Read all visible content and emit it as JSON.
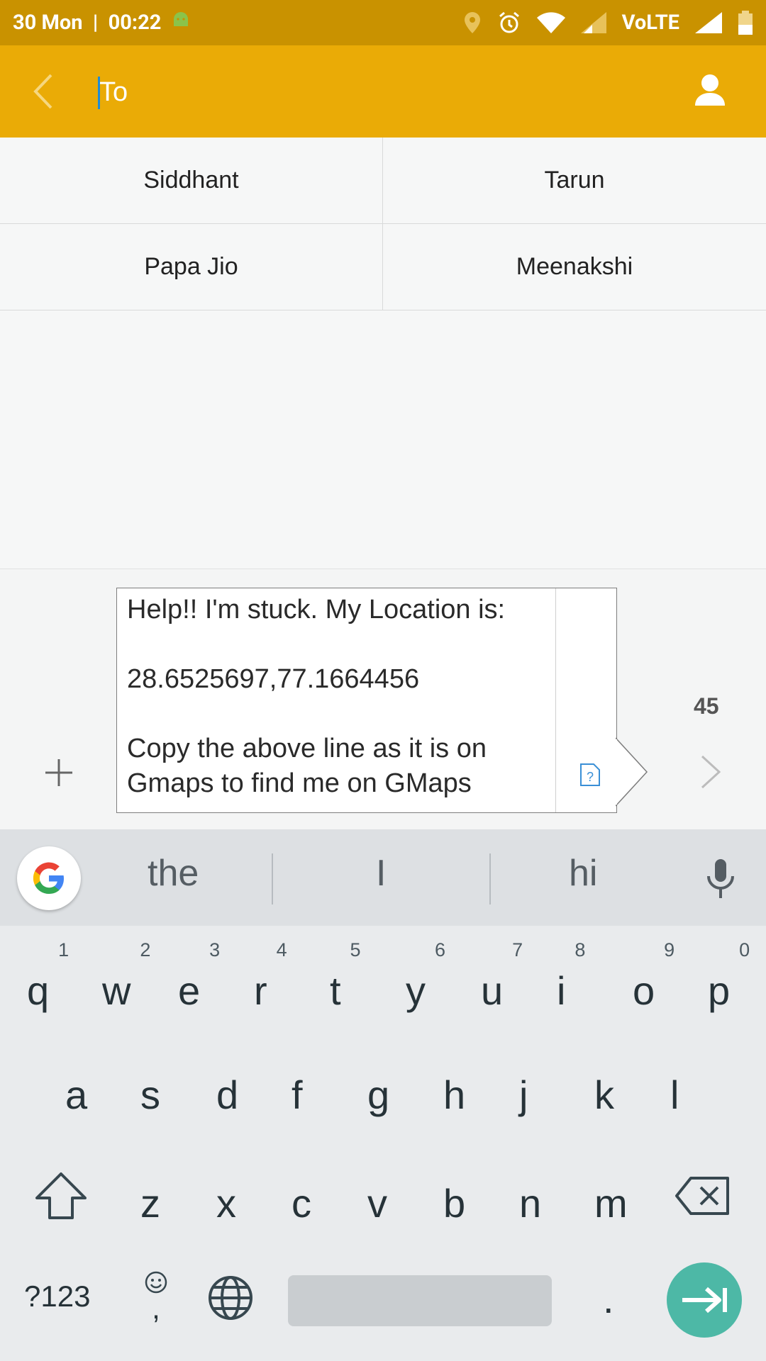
{
  "status_bar": {
    "date_time": "30 Mon  |  00:22",
    "network_label": "VoLTE"
  },
  "toolbar": {
    "to_placeholder": "To",
    "back_icon": "chevron-left-icon",
    "contact_icon": "person-icon"
  },
  "contacts": [
    {
      "name": "Siddhant"
    },
    {
      "name": "Tarun"
    },
    {
      "name": "Papa Jio"
    },
    {
      "name": "Meenakshi"
    }
  ],
  "compose": {
    "message": "Help!! I'm stuck. My Location is:\n\n28.6525697,77.1664456\n\nCopy the above line as it is on Gmaps to find me on GMaps",
    "char_count": "45",
    "attach_icon": "plus-icon",
    "send_icon": "chevron-right-icon"
  },
  "keyboard": {
    "suggestions": [
      "the",
      "I",
      "hi"
    ],
    "row1": [
      {
        "key": "q",
        "hint": "1"
      },
      {
        "key": "w",
        "hint": "2"
      },
      {
        "key": "e",
        "hint": "3"
      },
      {
        "key": "r",
        "hint": "4"
      },
      {
        "key": "t",
        "hint": "5"
      },
      {
        "key": "y",
        "hint": "6"
      },
      {
        "key": "u",
        "hint": "7"
      },
      {
        "key": "i",
        "hint": "8"
      },
      {
        "key": "o",
        "hint": "9"
      },
      {
        "key": "p",
        "hint": "0"
      }
    ],
    "row2": [
      "a",
      "s",
      "d",
      "f",
      "g",
      "h",
      "j",
      "k",
      "l"
    ],
    "row3": [
      "z",
      "x",
      "c",
      "v",
      "b",
      "n",
      "m"
    ],
    "symbols_label": "?123",
    "comma_label": ",",
    "period_label": ".",
    "accent_color": "#4db8a6"
  }
}
